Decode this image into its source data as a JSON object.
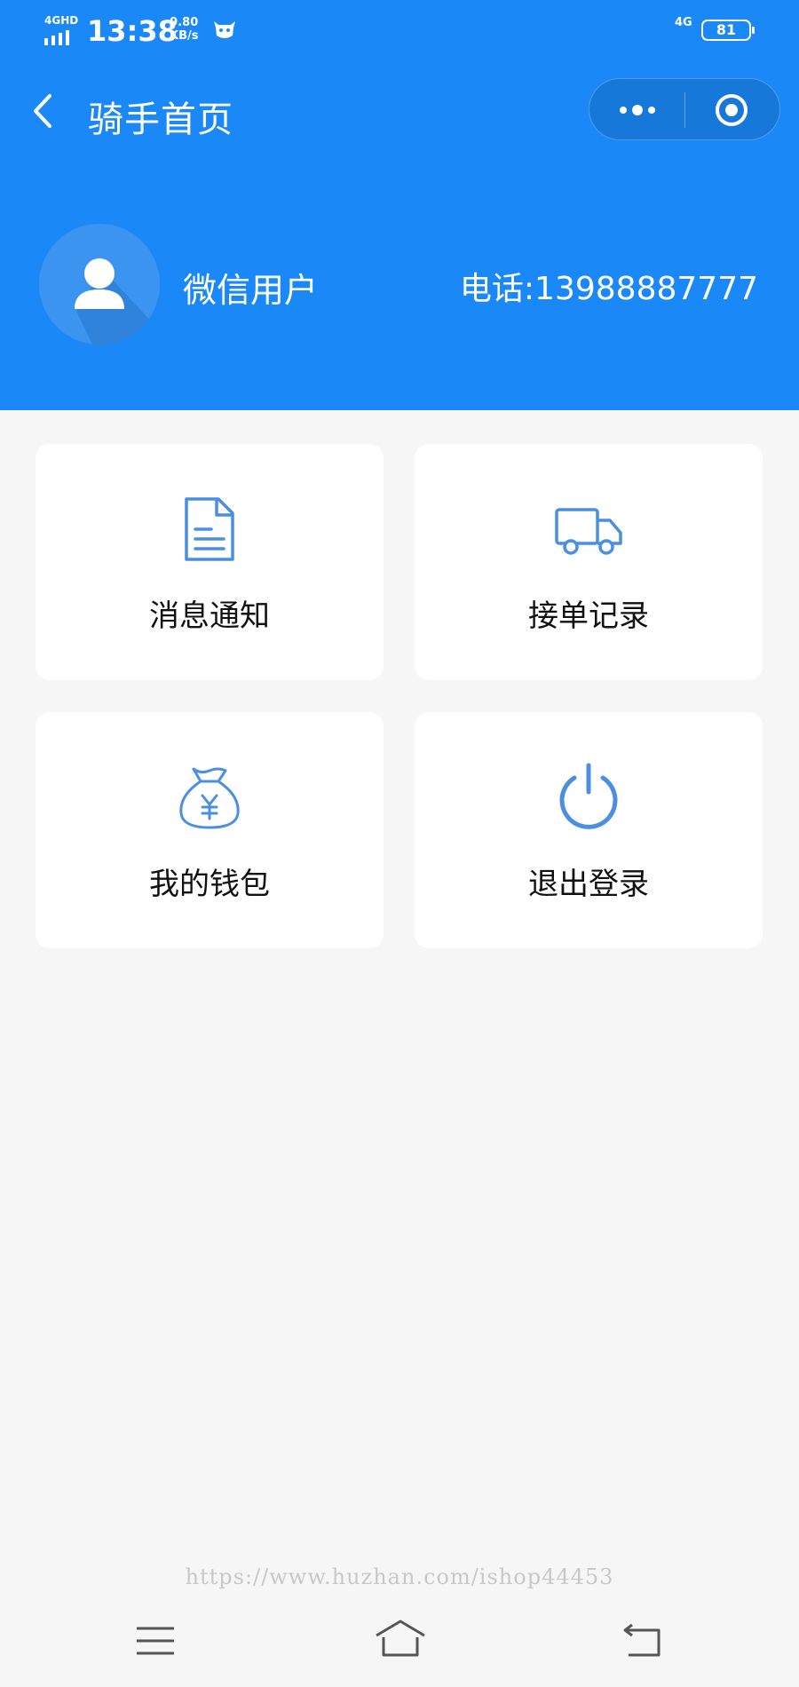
{
  "status_bar": {
    "network": "4GHD",
    "time": "13:38",
    "speed_value": "9.80",
    "speed_unit": "KB/s",
    "network_right": "4G",
    "battery": "81"
  },
  "nav": {
    "title": "骑手首页"
  },
  "profile": {
    "username": "微信用户",
    "phone": "电话:13988887777"
  },
  "menu": [
    {
      "label": "消息通知",
      "icon": "document-icon"
    },
    {
      "label": "接单记录",
      "icon": "truck-icon"
    },
    {
      "label": "我的钱包",
      "icon": "money-bag-icon"
    },
    {
      "label": "退出登录",
      "icon": "power-icon"
    }
  ],
  "watermark": "https://www.huzhan.com/ishop44453",
  "colors": {
    "header_bg": "#1a89f7",
    "icon_blue": "#4a8fe0",
    "page_bg": "#f6f6f6"
  }
}
